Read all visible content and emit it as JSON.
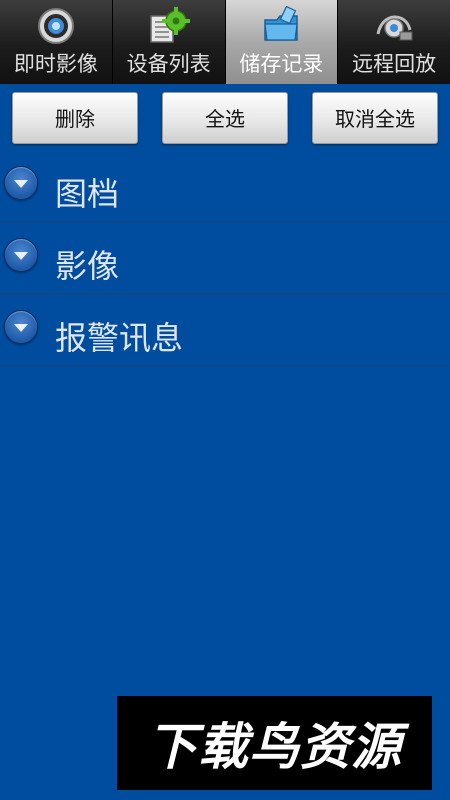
{
  "tabs": [
    {
      "label": "即时影像",
      "icon": "camera-lens-icon",
      "active": false
    },
    {
      "label": "设备列表",
      "icon": "device-list-gear-icon",
      "active": false
    },
    {
      "label": "储存记录",
      "icon": "storage-folder-icon",
      "active": true
    },
    {
      "label": "远程回放",
      "icon": "remote-playback-icon",
      "active": false
    }
  ],
  "actions": {
    "delete_label": "删除",
    "select_all_label": "全选",
    "deselect_all_label": "取消全选"
  },
  "groups": [
    {
      "label": "图档",
      "expanded": false
    },
    {
      "label": "影像",
      "expanded": false
    },
    {
      "label": "报警讯息",
      "expanded": false
    }
  ],
  "watermark": {
    "text": "下载鸟资源"
  },
  "colors": {
    "background": "#004da0",
    "tabbar": "#1a1a1a",
    "active_tab": "#b5b5b5",
    "group_label": "#dfe6f0"
  }
}
